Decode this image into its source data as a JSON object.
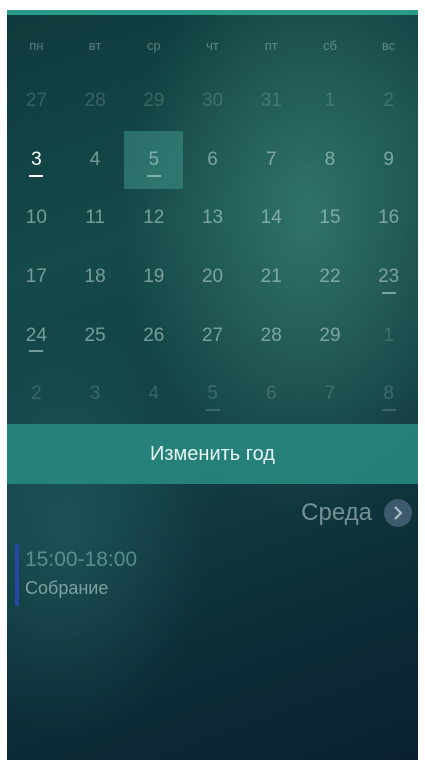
{
  "weekdays": [
    "пн",
    "вт",
    "ср",
    "чт",
    "пт",
    "сб",
    "вс"
  ],
  "weeks": [
    [
      {
        "label": "27",
        "in_month": false,
        "event": false
      },
      {
        "label": "28",
        "in_month": false,
        "event": false
      },
      {
        "label": "29",
        "in_month": false,
        "event": false
      },
      {
        "label": "30",
        "in_month": false,
        "event": false
      },
      {
        "label": "31",
        "in_month": false,
        "event": false
      },
      {
        "label": "1",
        "in_month": false,
        "event": false
      },
      {
        "label": "2",
        "in_month": false,
        "event": false
      }
    ],
    [
      {
        "label": "3",
        "in_month": true,
        "event": true,
        "today": true
      },
      {
        "label": "4",
        "in_month": true,
        "event": false
      },
      {
        "label": "5",
        "in_month": true,
        "event": true,
        "selected": true
      },
      {
        "label": "6",
        "in_month": true,
        "event": false
      },
      {
        "label": "7",
        "in_month": true,
        "event": false
      },
      {
        "label": "8",
        "in_month": true,
        "event": false
      },
      {
        "label": "9",
        "in_month": true,
        "event": false
      }
    ],
    [
      {
        "label": "10",
        "in_month": true,
        "event": false
      },
      {
        "label": "11",
        "in_month": true,
        "event": false
      },
      {
        "label": "12",
        "in_month": true,
        "event": false
      },
      {
        "label": "13",
        "in_month": true,
        "event": false
      },
      {
        "label": "14",
        "in_month": true,
        "event": false
      },
      {
        "label": "15",
        "in_month": true,
        "event": false
      },
      {
        "label": "16",
        "in_month": true,
        "event": false
      }
    ],
    [
      {
        "label": "17",
        "in_month": true,
        "event": false
      },
      {
        "label": "18",
        "in_month": true,
        "event": false
      },
      {
        "label": "19",
        "in_month": true,
        "event": false
      },
      {
        "label": "20",
        "in_month": true,
        "event": false
      },
      {
        "label": "21",
        "in_month": true,
        "event": false
      },
      {
        "label": "22",
        "in_month": true,
        "event": false
      },
      {
        "label": "23",
        "in_month": true,
        "event": true
      }
    ],
    [
      {
        "label": "24",
        "in_month": true,
        "event": true
      },
      {
        "label": "25",
        "in_month": true,
        "event": false
      },
      {
        "label": "26",
        "in_month": true,
        "event": false
      },
      {
        "label": "27",
        "in_month": true,
        "event": false
      },
      {
        "label": "28",
        "in_month": true,
        "event": false
      },
      {
        "label": "29",
        "in_month": true,
        "event": false
      },
      {
        "label": "1",
        "in_month": false,
        "event": false
      }
    ],
    [
      {
        "label": "2",
        "in_month": false,
        "event": false
      },
      {
        "label": "3",
        "in_month": false,
        "event": false
      },
      {
        "label": "4",
        "in_month": false,
        "event": false
      },
      {
        "label": "5",
        "in_month": false,
        "event": true
      },
      {
        "label": "6",
        "in_month": false,
        "event": false
      },
      {
        "label": "7",
        "in_month": false,
        "event": false
      },
      {
        "label": "8",
        "in_month": false,
        "event": true
      }
    ]
  ],
  "change_year_label": "Изменить год",
  "selected_day_name": "Среда",
  "next_icon": "chevron-right-icon",
  "events": [
    {
      "time": "15:00-18:00",
      "title": "Собрание",
      "color": "#2447a8"
    }
  ],
  "colors": {
    "accent": "#2a9a8d",
    "selected": "#2f8f86"
  }
}
